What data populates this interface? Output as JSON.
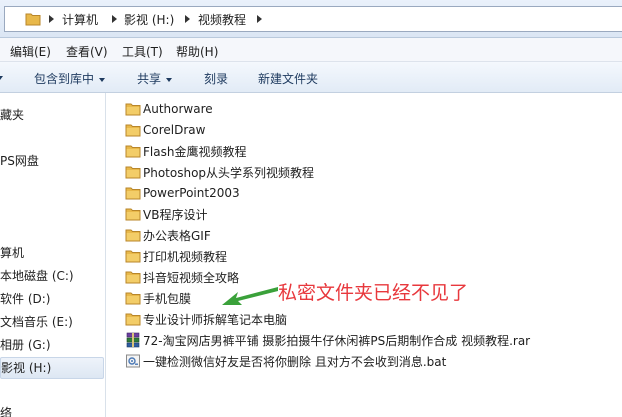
{
  "address": {
    "crumbs": [
      "计算机",
      "影视 (H:)",
      "视频教程"
    ]
  },
  "menu": {
    "items": [
      "编辑(E)",
      "查看(V)",
      "工具(T)",
      "帮助(H)"
    ]
  },
  "commands": {
    "include_library": "包含到库中",
    "share": "共享",
    "burn": "刻录",
    "new_folder": "新建文件夹"
  },
  "nav": {
    "items": [
      "藏夹",
      "PS网盘",
      "算机",
      "本地磁盘 (C:)",
      "软件 (D:)",
      "文档音乐 (E:)",
      "相册 (G:)",
      "影视 (H:)",
      "络"
    ],
    "selected": "影视 (H:)"
  },
  "files": [
    {
      "name": "Authorware",
      "icon": "folder-icon"
    },
    {
      "name": "CorelDraw",
      "icon": "folder-icon"
    },
    {
      "name": "Flash金鹰视频教程",
      "icon": "folder-icon"
    },
    {
      "name": "Photoshop从头学系列视频教程",
      "icon": "folder-icon"
    },
    {
      "name": "PowerPoint2003",
      "icon": "folder-icon"
    },
    {
      "name": "VB程序设计",
      "icon": "folder-icon"
    },
    {
      "name": "办公表格GIF",
      "icon": "folder-icon"
    },
    {
      "name": "打印机视频教程",
      "icon": "folder-icon"
    },
    {
      "name": "抖音短视频全攻略",
      "icon": "folder-icon"
    },
    {
      "name": "手机包膜",
      "icon": "folder-icon"
    },
    {
      "name": "专业设计师拆解笔记本电脑",
      "icon": "folder-icon"
    },
    {
      "name": "72-淘宝网店男裤平铺 摄影拍摄牛仔休闲裤PS后期制作合成 视频教程.rar",
      "icon": "rar-archive-icon"
    },
    {
      "name": "一键检测微信好友是否将你删除 且对方不会收到消息.bat",
      "icon": "batch-file-icon"
    }
  ],
  "annotation": {
    "text": "私密文件夹已经不见了",
    "color": "#e8383d",
    "arrow_color": "#3aa13a"
  },
  "colors": {
    "folder": "#e8b84a",
    "selected_bg": "#dde7f3"
  }
}
